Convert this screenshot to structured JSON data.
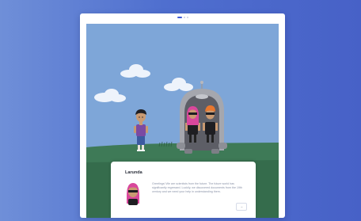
{
  "progress": {
    "current": 1,
    "total": 3
  },
  "dialog": {
    "speaker": "Larunda",
    "message": "Greetings! We are scientists from the future. The future world has significantly regressed. Luckily, we discovered documents from the 19th century and we need your help in understanding them.",
    "next_label": "→"
  },
  "colors": {
    "background_left": "#6f8fd8",
    "background_right": "#4761c7",
    "sky": "#7ea6d8",
    "grass": "#3e7a57",
    "accent": "#3d5bd6"
  },
  "icons": {
    "next": "arrow-right-icon"
  }
}
